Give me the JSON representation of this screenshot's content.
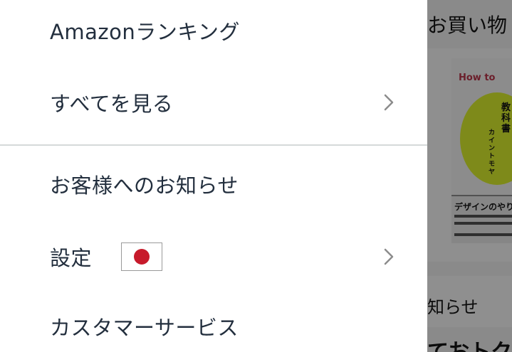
{
  "drawer": {
    "items": [
      {
        "label": "Amazonランキング",
        "has_chevron": false
      },
      {
        "label": "すべてを見る",
        "has_chevron": true
      },
      {
        "label": "お客様へのお知らせ",
        "has_chevron": false
      },
      {
        "label": "設定",
        "has_chevron": true,
        "flag": "japan-flag-icon"
      },
      {
        "label": "カスタマーサービス",
        "has_chevron": false
      }
    ]
  },
  "background": {
    "title": "お買い物",
    "book_top": "How to",
    "book_vertical": "教科書",
    "book_vertical_small": "カイントモヤ",
    "book_band": "デザインのやりか",
    "notice": "知らせ",
    "bottom": "ておトク"
  },
  "colors": {
    "text": "#232f3e",
    "divider": "#d5d9d9",
    "chevron": "#8c8c8c",
    "flag_red": "#c71a2b",
    "overlay": "#7f7f7f"
  }
}
